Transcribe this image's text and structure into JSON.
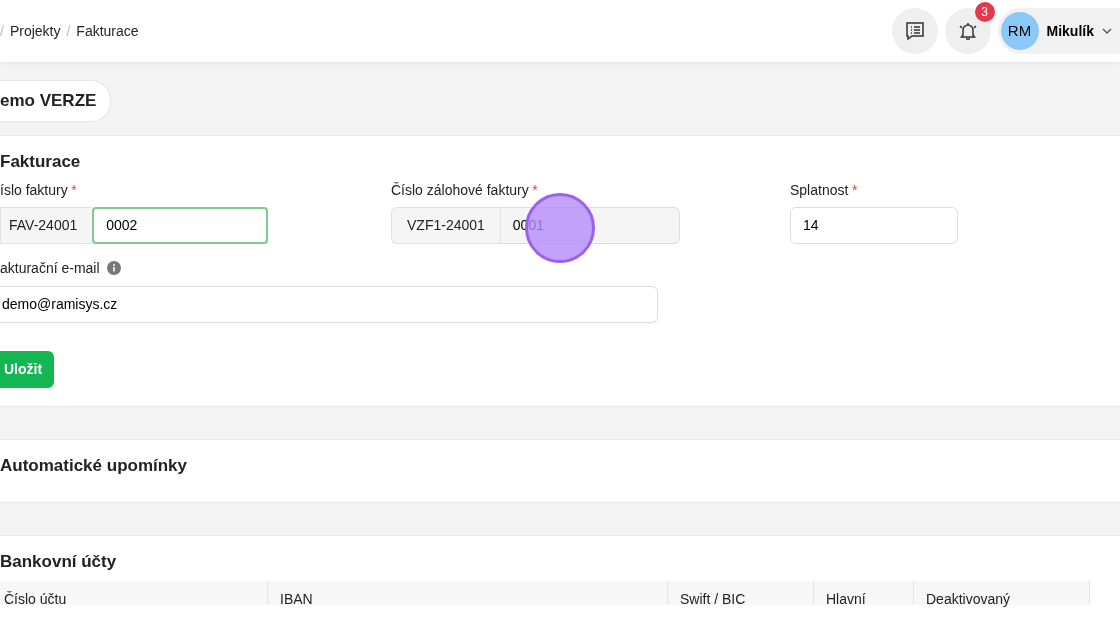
{
  "breadcrumb": {
    "separator": "/",
    "items": [
      "Projekty",
      "Fakturace"
    ]
  },
  "header": {
    "notifications_count": "3",
    "user": {
      "initials": "RM",
      "name": "Mikulík"
    }
  },
  "version_pill": "emo VERZE",
  "invoicing": {
    "title": "Fakturace",
    "required_mark": "*",
    "fields": [
      {
        "kind": "prefixed",
        "label": "íslo faktury",
        "required": true,
        "prefix_text": "FAV-24001",
        "value": "0002",
        "focused": true,
        "readonly": false
      },
      {
        "kind": "prefixed",
        "label": "Číslo zálohové faktury",
        "required": true,
        "prefix_text": "VZF1-24001",
        "value": "0001",
        "focused": false,
        "readonly": true
      },
      {
        "kind": "plain",
        "label": "Splatnost",
        "required": true,
        "value": "14",
        "focused": false,
        "readonly": false
      }
    ],
    "email": {
      "label": "akturační e-mail",
      "info": true,
      "value": "demo@ramisys.cz"
    },
    "save_button": "Uložit"
  },
  "reminders": {
    "title": "Automatické upomínky"
  },
  "bank_accounts": {
    "title": "Bankovní účty",
    "columns": [
      "Číslo účtu",
      "IBAN",
      "Swift / BIC",
      "Hlavní",
      "Deaktivovaný"
    ]
  }
}
